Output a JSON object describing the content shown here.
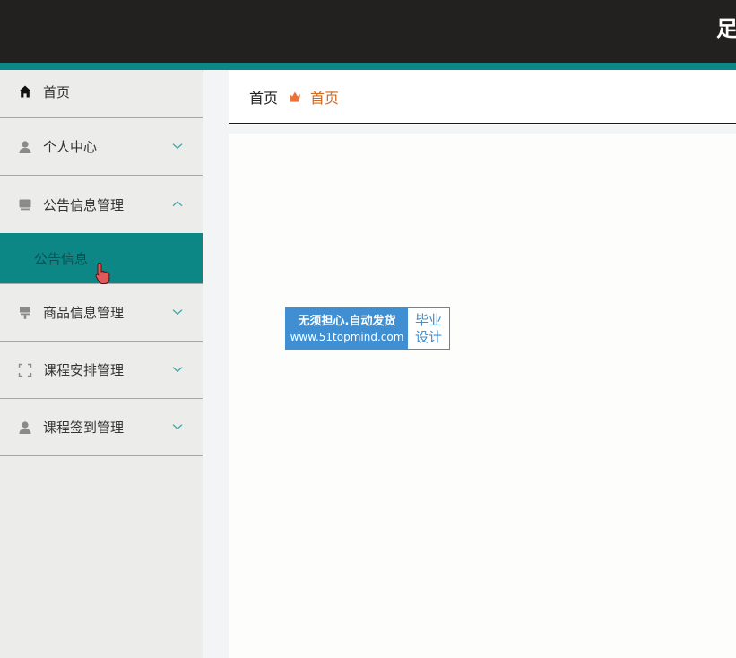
{
  "header": {
    "title": "足"
  },
  "sidebar": {
    "items": [
      {
        "label": "首页",
        "icon": "home-icon"
      },
      {
        "label": "个人中心",
        "icon": "user-icon"
      },
      {
        "label": "公告信息管理",
        "icon": "inbox-icon",
        "expanded": true,
        "children": [
          {
            "label": "公告信息"
          }
        ]
      },
      {
        "label": "商品信息管理",
        "icon": "brush-icon"
      },
      {
        "label": "课程安排管理",
        "icon": "frame-icon"
      },
      {
        "label": "课程签到管理",
        "icon": "user-icon"
      }
    ]
  },
  "breadcrumb": {
    "home": "首页",
    "current": "首页"
  },
  "watermark": {
    "line1": "无须担心.自动发货",
    "line2": "www.51topmind.com",
    "side1": "毕业",
    "side2": "设计"
  },
  "colors": {
    "topbar": "#222120",
    "accent": "#0d8686",
    "crumb_current": "#d2691e",
    "watermark": "#3f8fd2"
  }
}
